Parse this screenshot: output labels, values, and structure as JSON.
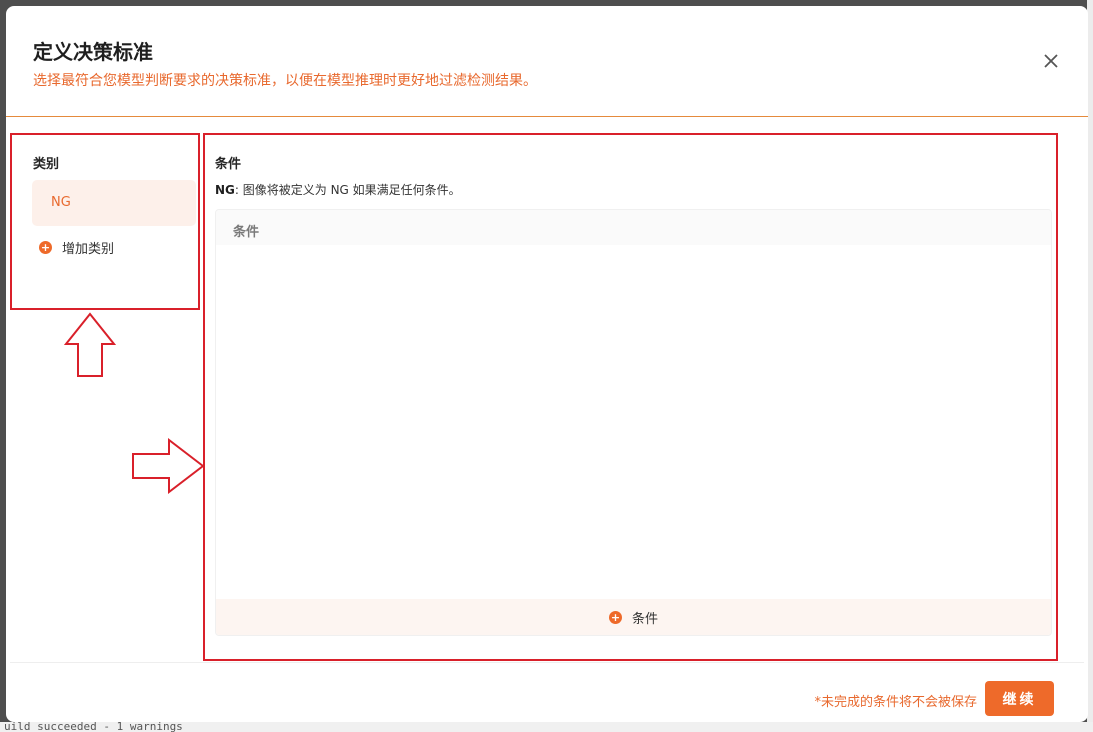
{
  "dialog": {
    "title": "定义决策标准",
    "subtitle": "选择最符合您模型判断要求的决策标准，以便在模型推理时更好地过滤检测结果。"
  },
  "categories": {
    "title": "类别",
    "items": [
      {
        "label": "NG"
      }
    ],
    "add_label": "增加类别"
  },
  "conditions": {
    "title": "条件",
    "desc_prefix": "NG",
    "desc_text": ": 图像将被定义为 NG 如果满足任何条件。",
    "table_header": "条件",
    "add_label": "条件"
  },
  "footer": {
    "note": "*未完成的条件将不会被保存",
    "continue_label": "继续"
  },
  "background": {
    "peek_text": "uild succeeded - 1 warnings"
  },
  "colors": {
    "accent": "#ee6a2a",
    "annotation_red": "#d9202a"
  },
  "icons": {
    "close": "close-icon",
    "add": "plus-circle-icon"
  }
}
